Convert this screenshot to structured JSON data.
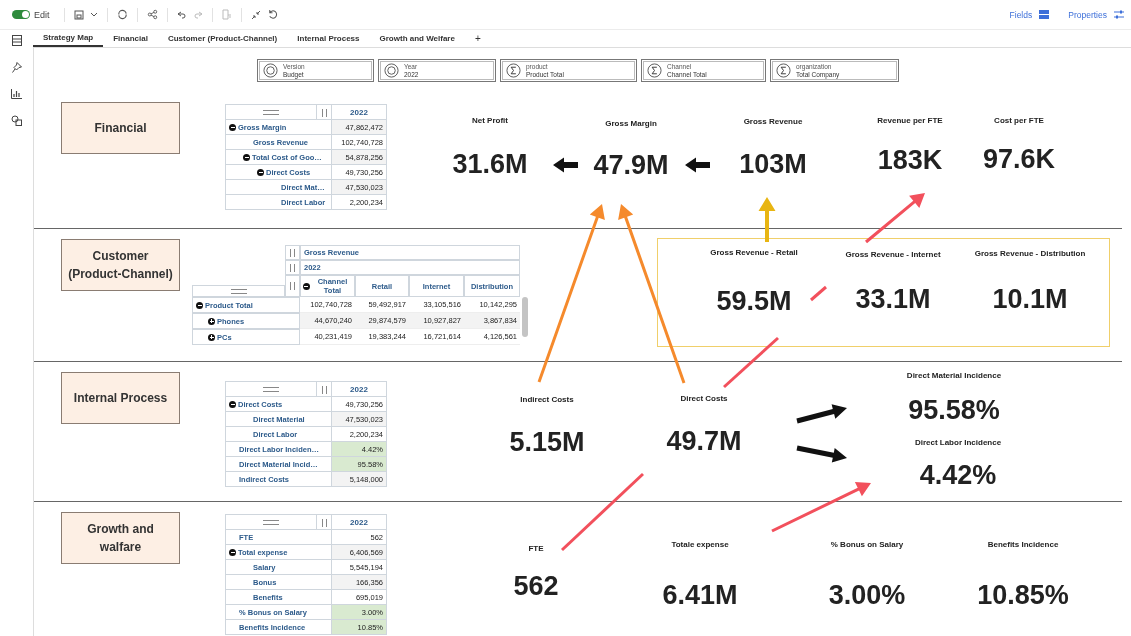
{
  "toolbar": {
    "edit_on": true,
    "edit_label": "Edit",
    "fields_label": "Fields",
    "properties_label": "Properties"
  },
  "tabs": [
    {
      "label": "Strategy Map",
      "selected": true
    },
    {
      "label": "Financial",
      "selected": false
    },
    {
      "label": "Customer (Product-Channel)",
      "selected": false
    },
    {
      "label": "Internal Process",
      "selected": false
    },
    {
      "label": "Growth and Welfare",
      "selected": false
    }
  ],
  "add_tab": "+",
  "filters": [
    {
      "kind": "member",
      "dimension": "Version",
      "value": "Budget"
    },
    {
      "kind": "member",
      "dimension": "Year",
      "value": "2022"
    },
    {
      "kind": "total",
      "dimension": "product",
      "value": "Product Total"
    },
    {
      "kind": "total",
      "dimension": "Channel",
      "value": "Channel Total"
    },
    {
      "kind": "total",
      "dimension": "organization",
      "value": "Total Company"
    }
  ],
  "sections": [
    {
      "title": "Financial",
      "table": {
        "kind": "list",
        "column": "2022",
        "rows": [
          {
            "label": "Gross Margin",
            "value": "47,862,472",
            "highlighted": false,
            "expanded": true,
            "children": [
              {
                "label": "Gross Revenue",
                "value": "102,740,728",
                "highlighted": false
              },
              {
                "label": "Total Cost of Goo…",
                "value": "54,878,256",
                "highlighted": false,
                "expanded": true,
                "children": [
                  {
                    "label": "Direct Costs",
                    "value": "49,730,256",
                    "highlighted": false,
                    "expanded": true,
                    "children": [
                      {
                        "label": "Direct Mat…",
                        "value": "47,530,023",
                        "highlighted": false
                      },
                      {
                        "label": "Direct Labor",
                        "value": "2,200,234",
                        "highlighted": false
                      }
                    ]
                  }
                ]
              }
            ]
          }
        ]
      },
      "kpis": [
        {
          "label": "Net Profit",
          "value": "31.6M"
        },
        {
          "label": "Gross Margin",
          "value": "47.9M"
        },
        {
          "label": "Gross Revenue",
          "value": "103M"
        },
        {
          "label": "Revenue per FTE",
          "value": "183K"
        },
        {
          "label": "Cost per FTE",
          "value": "97.6K"
        }
      ]
    },
    {
      "title": "Customer (Product-Channel)",
      "table": {
        "kind": "crosstab",
        "measure": "Gross Revenue",
        "year": "2022",
        "columns": [
          {
            "label": "Channel Total",
            "expanded": true,
            "children": [
              {
                "label": "Retail"
              },
              {
                "label": "Internet"
              },
              {
                "label": "Distribution"
              }
            ]
          }
        ],
        "rows": [
          {
            "label": "Product Total",
            "expanded": true,
            "values": [
              "102,740,728",
              "59,492,917",
              "33,105,516",
              "10,142,295"
            ],
            "children": [
              {
                "label": "Phones",
                "expanded": false,
                "values": [
                  "44,670,240",
                  "29,874,579",
                  "10,927,827",
                  "3,867,834"
                ]
              },
              {
                "label": "PCs",
                "expanded": false,
                "values": [
                  "40,231,419",
                  "19,383,244",
                  "16,721,614",
                  "4,126,561"
                ]
              }
            ]
          }
        ]
      },
      "kpi_panel": [
        {
          "label": "Gross Revenue - Retail",
          "value": "59.5M"
        },
        {
          "label": "Gross Revenue - Internet",
          "value": "33.1M"
        },
        {
          "label": "Gross Revenue - Distribution",
          "value": "10.1M"
        }
      ]
    },
    {
      "title": "Internal Process",
      "table": {
        "kind": "list",
        "column": "2022",
        "rows": [
          {
            "label": "Direct Costs",
            "value": "49,730,256",
            "highlighted": false,
            "expanded": true,
            "children": [
              {
                "label": "Direct Material",
                "value": "47,530,023",
                "highlighted": false
              },
              {
                "label": "Direct Labor",
                "value": "2,200,234",
                "highlighted": false
              }
            ]
          },
          {
            "label": "Direct Labor Inciden…",
            "value": "4.42%",
            "highlighted": true
          },
          {
            "label": "Direct Material Incid…",
            "value": "95.58%",
            "highlighted": true
          },
          {
            "label": "Indirect Costs",
            "value": "5,148,000",
            "highlighted": false
          }
        ]
      },
      "kpis": [
        {
          "label": "Indirect Costs",
          "value": "5.15M"
        },
        {
          "label": "Direct Costs",
          "value": "49.7M"
        },
        {
          "label": "Direct Material Incidence",
          "value": "95.58%"
        },
        {
          "label": "Direct Labor Incidence",
          "value": "4.42%"
        }
      ]
    },
    {
      "title": "Growth and walfare",
      "table": {
        "kind": "list",
        "column": "2022",
        "rows": [
          {
            "label": "FTE",
            "value": "562",
            "highlighted": false
          },
          {
            "label": "Total expense",
            "value": "6,406,569",
            "highlighted": false,
            "expanded": true,
            "children": [
              {
                "label": "Salary",
                "value": "5,545,194",
                "highlighted": false
              },
              {
                "label": "Bonus",
                "value": "166,356",
                "highlighted": false
              },
              {
                "label": "Benefits",
                "value": "695,019",
                "highlighted": false
              }
            ]
          },
          {
            "label": "% Bonus on Salary",
            "value": "3.00%",
            "highlighted": true
          },
          {
            "label": "Benefits Incidence",
            "value": "10.85%",
            "highlighted": true
          }
        ]
      },
      "kpis": [
        {
          "label": "FTE",
          "value": "562"
        },
        {
          "label": "Totale expense",
          "value": "6.41M"
        },
        {
          "label": "% Bonus on Salary",
          "value": "3.00%"
        },
        {
          "label": "Benefits Incidence",
          "value": "10.85%"
        }
      ]
    }
  ]
}
